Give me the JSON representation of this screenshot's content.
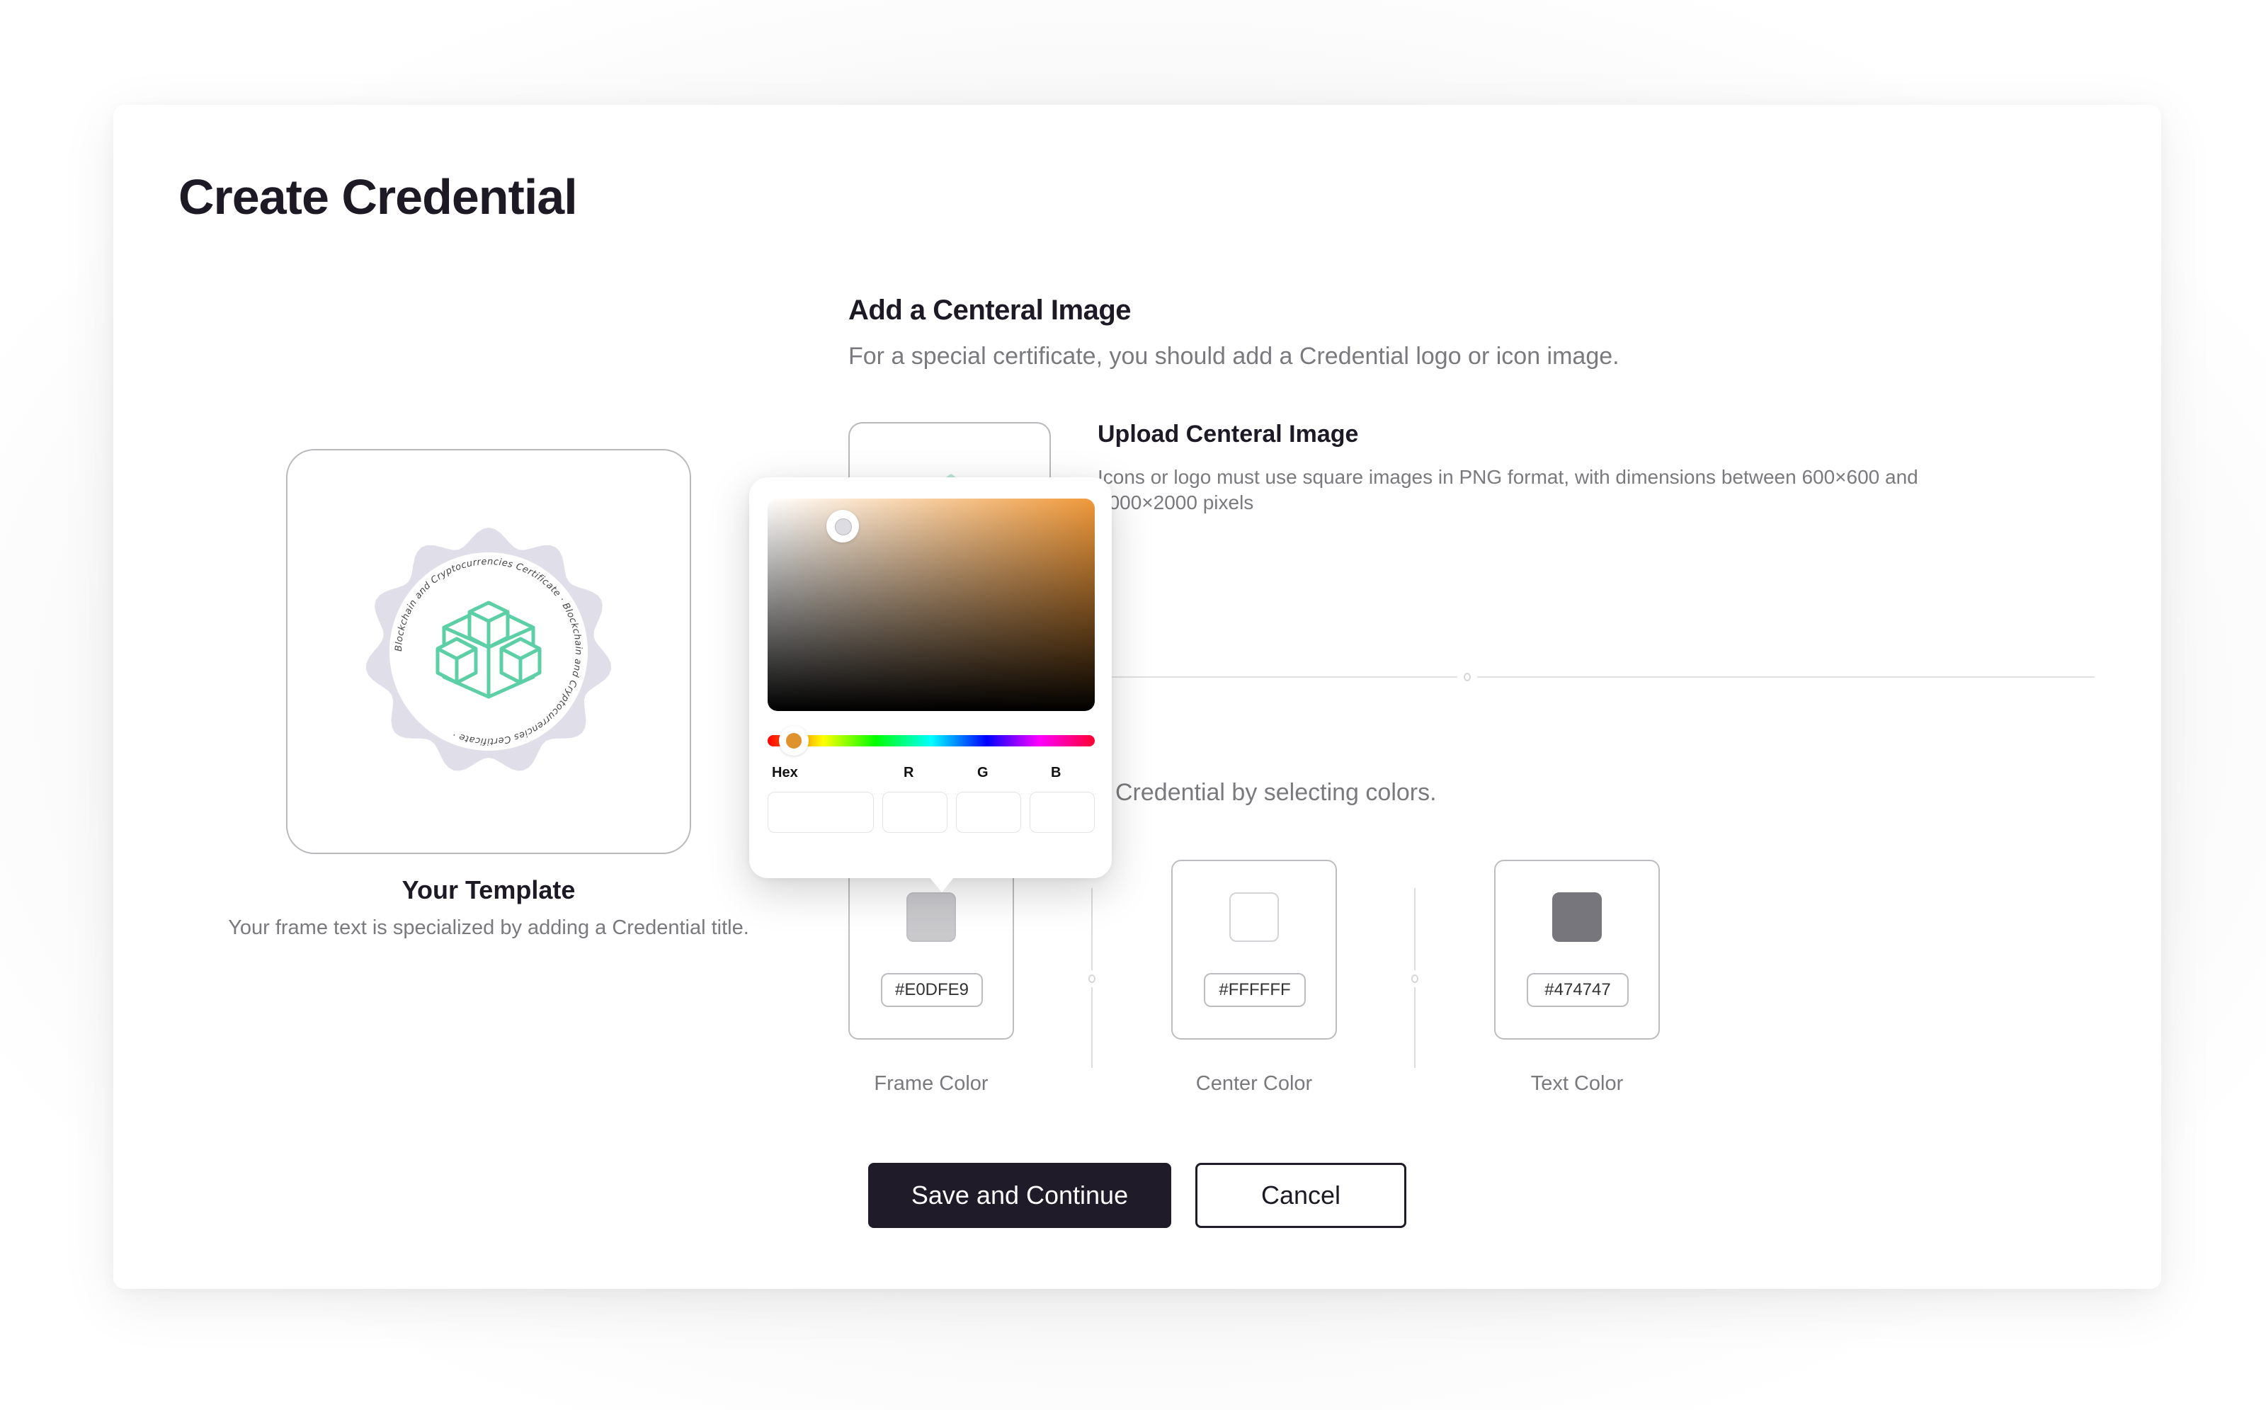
{
  "page": {
    "title": "Create Credential"
  },
  "template": {
    "title": "Your Template",
    "description": "Your frame text is specialized by adding a Credential title.",
    "badge_ring_text": "Blockchain and Cryptocurrencies Certificate · Blockchain and Cryptocurrencies Certificate · ",
    "badge_icon": "blocks-cube-icon",
    "colors": {
      "frame": "#E0DFE9",
      "center": "#FFFFFF",
      "text": "#474747",
      "icon": "#5ccfa6"
    }
  },
  "central_image": {
    "section_title": "Add a Centeral Image",
    "section_description": "For a special certificate, you should add a Credential logo or icon image.",
    "upload_title": "Upload Centeral Image",
    "upload_description": "Icons or logo must use square images in PNG format, with dimensions between 600×600 and 2000×2000 pixels"
  },
  "colors_section": {
    "description_visible": "Credential by selecting colors.",
    "items": [
      {
        "label": "Frame Color",
        "hex": "#E0DFE9",
        "swatch": "#c9c9cc"
      },
      {
        "label": "Center Color",
        "hex": "#FFFFFF",
        "swatch": "#ffffff"
      },
      {
        "label": "Text Color",
        "hex": "#474747",
        "swatch": "#77767c"
      }
    ]
  },
  "color_picker": {
    "hue_color": "#f0993a",
    "hue_thumb_color": "#e0922c",
    "hue_position": 0.08,
    "saturation": 0.23,
    "value": 0.87,
    "labels": {
      "hex": "Hex",
      "r": "R",
      "g": "G",
      "b": "B"
    },
    "values": {
      "hex": "",
      "r": "",
      "g": "",
      "b": ""
    }
  },
  "actions": {
    "save_label": "Save and Continue",
    "cancel_label": "Cancel"
  }
}
